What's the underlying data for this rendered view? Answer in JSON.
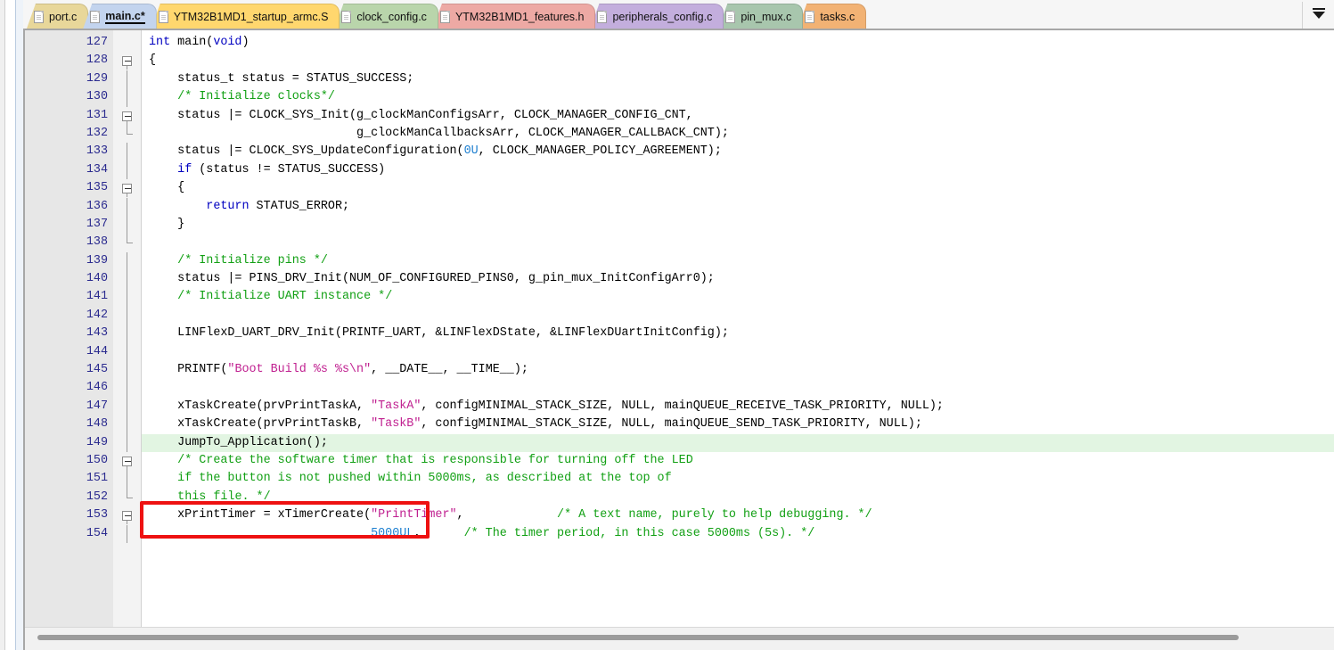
{
  "tabs": [
    {
      "label": "port.c",
      "color": "#e8d79a",
      "active": false,
      "modified": false,
      "icon": "file-icon"
    },
    {
      "label": "main.c*",
      "color": "#c3d4ee",
      "active": true,
      "modified": true,
      "icon": "file-icon"
    },
    {
      "label": "YTM32B1MD1_startup_armc.S",
      "color": "#ffd76e",
      "active": false,
      "modified": false,
      "icon": "file-icon"
    },
    {
      "label": "clock_config.c",
      "color": "#b9d5ab",
      "active": false,
      "modified": false,
      "icon": "file-icon"
    },
    {
      "label": "YTM32B1MD1_features.h",
      "color": "#eda9a4",
      "active": false,
      "modified": false,
      "icon": "file-icon"
    },
    {
      "label": "peripherals_config.c",
      "color": "#c3aedd",
      "active": false,
      "modified": false,
      "icon": "file-icon"
    },
    {
      "label": "pin_mux.c",
      "color": "#a8c6ad",
      "active": false,
      "modified": false,
      "icon": "file-icon"
    },
    {
      "label": "tasks.c",
      "color": "#f2b274",
      "active": false,
      "modified": false,
      "icon": "file-icon"
    }
  ],
  "tab_overflow": {
    "icon": "chevron-down-icon",
    "label": ""
  },
  "editor": {
    "active_file": "main.c*",
    "highlighted_line": 149,
    "first_visible_line": 127,
    "last_visible_line": 154,
    "lines": [
      {
        "n": "127",
        "fold": "none",
        "html": "<span class=\"k\">int</span> main(<span class=\"k\">void</span>)"
      },
      {
        "n": "128",
        "fold": "box-start",
        "html": "{"
      },
      {
        "n": "129",
        "fold": "stem",
        "html": "    status_t status = STATUS_SUCCESS;"
      },
      {
        "n": "130",
        "fold": "stem",
        "html": "    <span class=\"cm\">/* Initialize clocks*/</span>"
      },
      {
        "n": "131",
        "fold": "box-mid",
        "html": "    status |= CLOCK_SYS_Init(g_clockManConfigsArr, CLOCK_MANAGER_CONFIG_CNT,"
      },
      {
        "n": "132",
        "fold": "end",
        "html": "                             g_clockManCallbacksArr, CLOCK_MANAGER_CALLBACK_CNT);"
      },
      {
        "n": "133",
        "fold": "stem",
        "html": "    status |= CLOCK_SYS_UpdateConfiguration(<span class=\"num\">0U</span>, CLOCK_MANAGER_POLICY_AGREEMENT);"
      },
      {
        "n": "134",
        "fold": "stem",
        "html": "    <span class=\"k\">if</span> (status != STATUS_SUCCESS)"
      },
      {
        "n": "135",
        "fold": "box-mid",
        "html": "    {"
      },
      {
        "n": "136",
        "fold": "stem",
        "html": "        <span class=\"k\">return</span> STATUS_ERROR;"
      },
      {
        "n": "137",
        "fold": "stem",
        "html": "    }"
      },
      {
        "n": "138",
        "fold": "end",
        "html": ""
      },
      {
        "n": "139",
        "fold": "stem",
        "html": "    <span class=\"cm\">/* Initialize pins */</span>"
      },
      {
        "n": "140",
        "fold": "stem",
        "html": "    status |= PINS_DRV_Init(NUM_OF_CONFIGURED_PINS0, g_pin_mux_InitConfigArr0);"
      },
      {
        "n": "141",
        "fold": "stem",
        "html": "    <span class=\"cm\">/* Initialize UART instance */</span>"
      },
      {
        "n": "142",
        "fold": "stem",
        "html": ""
      },
      {
        "n": "143",
        "fold": "stem",
        "html": "    LINFlexD_UART_DRV_Init(PRINTF_UART, &amp;LINFlexDState, &amp;LINFlexDUartInitConfig);"
      },
      {
        "n": "144",
        "fold": "stem",
        "html": ""
      },
      {
        "n": "145",
        "fold": "stem",
        "html": "    PRINTF(<span class=\"st\">\"Boot Build %s %s\\n\"</span>, __DATE__, __TIME__);"
      },
      {
        "n": "146",
        "fold": "stem",
        "html": ""
      },
      {
        "n": "147",
        "fold": "stem",
        "html": "    xTaskCreate(prvPrintTaskA, <span class=\"st\">\"TaskA\"</span>, configMINIMAL_STACK_SIZE, NULL, mainQUEUE_RECEIVE_TASK_PRIORITY, NULL);"
      },
      {
        "n": "148",
        "fold": "stem",
        "html": "    xTaskCreate(prvPrintTaskB, <span class=\"st\">\"TaskB\"</span>, configMINIMAL_STACK_SIZE, NULL, mainQUEUE_SEND_TASK_PRIORITY, NULL);"
      },
      {
        "n": "149",
        "fold": "stem",
        "html": "    JumpTo_Application();",
        "highlight": true
      },
      {
        "n": "150",
        "fold": "box-mid",
        "html": "    <span class=\"cm\">/* Create the software timer that is responsible for turning off the LED</span>"
      },
      {
        "n": "151",
        "fold": "stem",
        "html": "    <span class=\"cm\">if the button is not pushed within 5000ms, as described at the top of</span>"
      },
      {
        "n": "152",
        "fold": "end",
        "html": "    <span class=\"cm\">this file. */</span>"
      },
      {
        "n": "153",
        "fold": "box-mid",
        "html": "    xPrintTimer = xTimerCreate(<span class=\"st\">\"PrintTimer\"</span>,             <span class=\"cm\">/* A text name, purely to help debugging. */</span>"
      },
      {
        "n": "154",
        "fold": "stem",
        "html": "                               <span class=\"num\">5000UL</span>,      <span class=\"cm\">/* The timer period, in this case 5000ms (5s). */</span>"
      }
    ]
  },
  "annotation": {
    "type": "rectangle",
    "color": "#ee1111",
    "target_line": "149",
    "target_text": "JumpTo_Application();"
  },
  "scrollbar": {
    "orientation": "horizontal",
    "name": "horizontal-scrollbar"
  },
  "colors": {
    "highlight_line_bg": "#e2f5e2",
    "gutter_bg": "#e7e7e7",
    "fold_gutter_bg": "#f3f3f3",
    "comment": "#12a014",
    "keyword": "#0000c0",
    "string": "#c02090",
    "number": "#1d7fd0",
    "line_number": "#2b2b8f",
    "annotation": "#ee1111"
  }
}
